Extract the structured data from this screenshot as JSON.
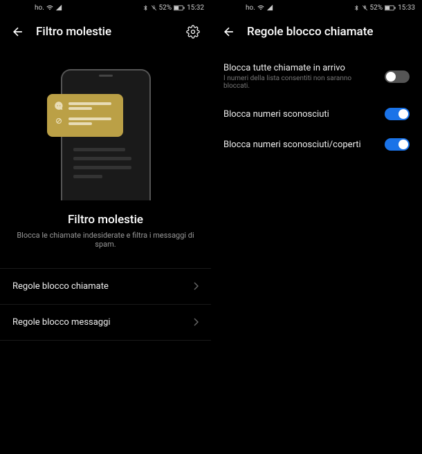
{
  "left": {
    "status": {
      "carrier": "ho.",
      "battery": "52%",
      "time": "15:32"
    },
    "header": {
      "title": "Filtro molestie"
    },
    "feature": {
      "title": "Filtro molestie",
      "desc": "Blocca le chiamate indesiderate e filtra i messaggi di spam."
    },
    "menu": {
      "calls": "Regole blocco chiamate",
      "messages": "Regole blocco messaggi"
    }
  },
  "right": {
    "status": {
      "carrier": "ho.",
      "battery": "52%",
      "time": "15:33"
    },
    "header": {
      "title": "Regole blocco chiamate"
    },
    "settings": {
      "block_all": {
        "label": "Blocca tutte chiamate in arrivo",
        "sub": "I numeri della lista consentiti non saranno bloccati.",
        "on": false
      },
      "unknown": {
        "label": "Blocca numeri sconosciuti",
        "on": true
      },
      "hidden": {
        "label": "Blocca numeri sconosciuti/coperti",
        "on": true
      }
    }
  }
}
